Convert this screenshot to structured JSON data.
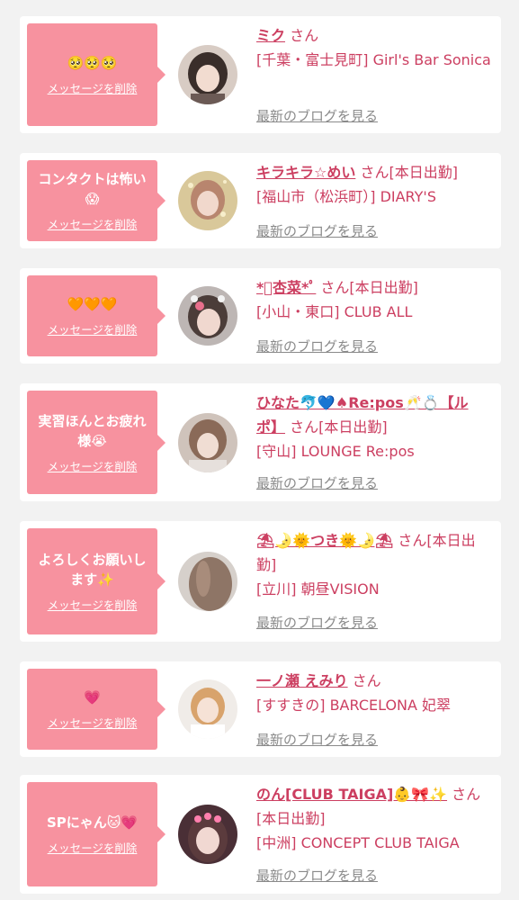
{
  "delete_label": "メッセージを削除",
  "blog_label": "最新のブログを見る",
  "accent_color": "#cc3f61",
  "bubble_color": "#f7929f",
  "items": [
    {
      "message": "🥺🥺🥺",
      "name": "ミク",
      "san": " さん",
      "shop": "[千葉・富士見町] Girl's Bar Sonica"
    },
    {
      "message": "コンタクトは怖い😱",
      "name": "キラキラ☆めい",
      "san": " さん[本日出勤]",
      "shop": "[福山市（松浜町）] DIARY'S"
    },
    {
      "message": "🧡🧡🧡",
      "name": "*ﾟ杏菜*ﾟ",
      "san": " さん[本日出勤]",
      "shop": "[小山・東口] CLUB ALL"
    },
    {
      "message": "実習ほんとお疲れ様😭",
      "name": "ひなた🐬💙♠Re:pos🥂💍【ルポ】",
      "san": " さん[本日出勤]",
      "shop": "[守山] LOUNGE Re:pos"
    },
    {
      "message": "よろしくお願いします✨",
      "name": "⛱🌛🌞つき🌞🌛⛱",
      "san": " さん[本日出勤]",
      "shop": "[立川] 朝昼VISION"
    },
    {
      "message": "💗",
      "name": "一ノ瀬 えみり",
      "san": " さん",
      "shop": "[すすきの] BARCELONA 妃翠"
    },
    {
      "message": "SPにゃん🐱💗",
      "name": "のん[CLUB TAIGA]👶🎀✨",
      "san": " さん[本日出勤]",
      "shop": "[中洲] CONCEPT CLUB TAIGA"
    }
  ]
}
